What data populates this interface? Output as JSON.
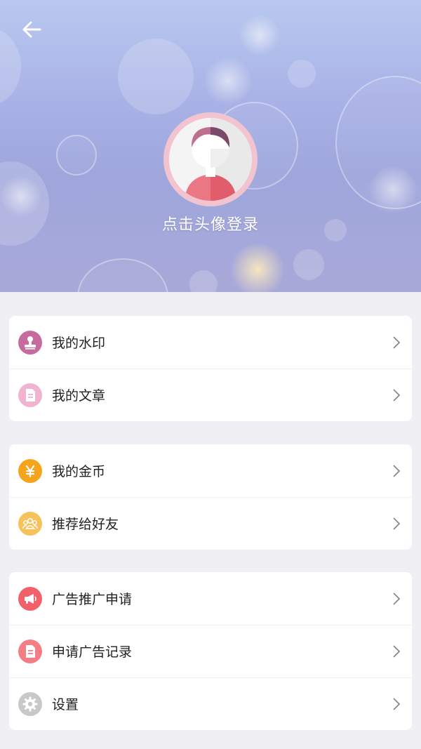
{
  "profile": {
    "login_hint": "点击头像登录"
  },
  "menu_groups": [
    {
      "items": [
        {
          "label": "我的水印",
          "icon": "stamp-icon",
          "color": "#c66a9f"
        },
        {
          "label": "我的文章",
          "icon": "document-icon",
          "color": "#f0b3d0"
        }
      ]
    },
    {
      "items": [
        {
          "label": "我的金币",
          "icon": "coin-icon",
          "color": "#f5a41b"
        },
        {
          "label": "推荐给好友",
          "icon": "friends-icon",
          "color": "#f7c25a"
        }
      ]
    },
    {
      "items": [
        {
          "label": "广告推广申请",
          "icon": "megaphone-icon",
          "color": "#f2616a"
        },
        {
          "label": "申请广告记录",
          "icon": "record-icon",
          "color": "#f57d84"
        },
        {
          "label": "设置",
          "icon": "gear-icon",
          "color": "#c8c8c8"
        }
      ]
    }
  ]
}
